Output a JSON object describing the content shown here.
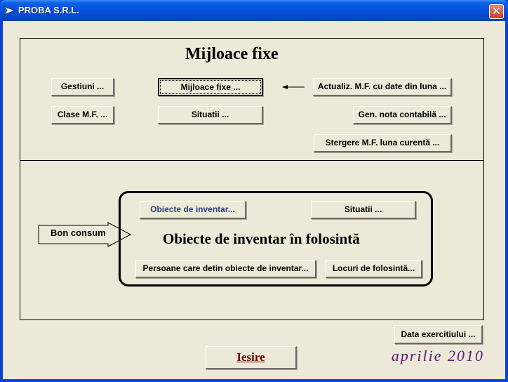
{
  "window": {
    "title": "PROBA S.R.L.",
    "close_symbol": "✕"
  },
  "fixed_assets": {
    "heading": "Mijloace fixe",
    "buttons": {
      "gestiuni": "Gestiuni ...",
      "mijloace_fixe": "Mijloace fixe ...",
      "actualiz": "Actualiz. M.F. cu date din luna ...",
      "clase": "Clase M.F. ...",
      "situatii": "Situatii  ...",
      "gen_nota": "Gen. nota contabilă ...",
      "stergere": "Stergere M.F. luna curentă ..."
    }
  },
  "inventory": {
    "heading": "Obiecte de inventar în folosintă",
    "arrow_label": "Bon consum",
    "buttons": {
      "obiecte": "Obiecte de inventar...",
      "situatii": "Situatii  ...",
      "persoane": "Persoane care detin obiecte de inventar...",
      "locuri": "Locuri de folosintă..."
    }
  },
  "footer": {
    "data_exercitiului": "Data exercitiului ...",
    "iesire": "Iesire",
    "period": "aprilie 2010"
  },
  "colors": {
    "title_bar": "#0653db",
    "face": "#ece9d8",
    "exit_text": "#7a0000",
    "period_text": "#5a1a7a",
    "blue_button_text": "#2c3d8c"
  }
}
